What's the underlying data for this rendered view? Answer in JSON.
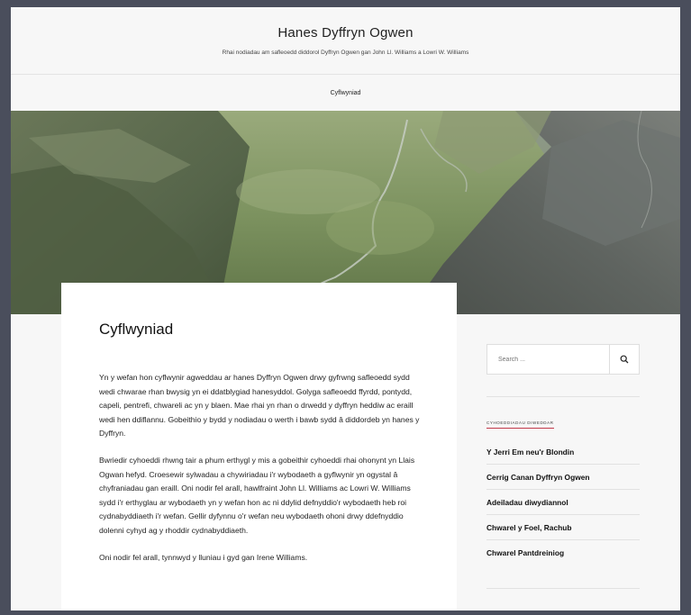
{
  "site": {
    "title": "Hanes Dyffryn Ogwen",
    "description": "Rhai nodiadau am safleoedd diddorol Dyffryn Ogwen gan John Ll. Williams a Lowri W. Williams"
  },
  "nav": {
    "items": [
      {
        "label": "Cyflwyniad"
      }
    ]
  },
  "article": {
    "title": "Cyflwyniad",
    "paragraphs": [
      "Yn y wefan hon cyflwynir agweddau ar hanes Dyffryn Ogwen drwy gyfrwng safleoedd sydd wedi chwarae rhan bwysig yn ei ddatblygiad hanesyddol. Golyga safleoedd ffyrdd, pontydd, capeli, pentrefi, chwareli ac yn y blaen. Mae rhai yn rhan o drwedd y dyffryn heddiw ac eraill wedi hen ddiflannu. Gobeithio y bydd y nodiadau o werth i bawb sydd â diddordeb yn hanes y Dyffryn.",
      "Bwriedir cyhoeddi rhwng tair a phum erthygl y mis a gobeithir cyhoeddi rhai ohonynt yn Llais Ogwan hefyd. Croesewir sylwadau a chywiriadau i'r wybodaeth a gyflwynir yn ogystal â chyfraniadau gan eraill. Oni nodir fel arall, hawlfraint John Ll. Williams ac Lowri W. Williams sydd i'r erthyglau ar wybodaeth yn y wefan hon ac ni ddylid defnyddio'r wybodaeth heb roi cydnabyddiaeth i'r wefan. Gellir dyfynnu o'r wefan neu wybodaeth ohoni drwy ddefnyddio dolenni cyhyd ag y rhoddir cydnabyddiaeth.",
      "Oni nodir fel arall, tynnwyd y lluniau i gyd gan Irene Williams."
    ]
  },
  "sidebar": {
    "search_placeholder": "Search ...",
    "widget_title": "CYHOEDDIADAU DIWEDDAR",
    "recent_posts": [
      {
        "label": "Y Jerri Em neu'r Blondin"
      },
      {
        "label": "Cerrig Canan Dyffryn Ogwen"
      },
      {
        "label": "Adeiladau diwydiannol"
      },
      {
        "label": "Chwarel y Foel, Rachub"
      },
      {
        "label": "Chwarel Pantdreiniog"
      }
    ]
  },
  "colors": {
    "accent": "#c23a4b",
    "page_bg": "#f7f7f7",
    "outer_bg": "#4a4e5c"
  },
  "icons": {
    "search": "search-icon",
    "hero": "hero-valley-image"
  }
}
